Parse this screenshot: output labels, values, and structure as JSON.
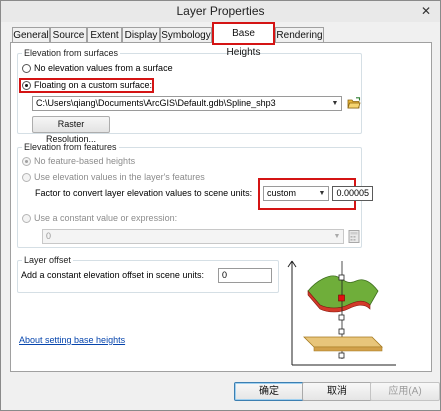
{
  "window": {
    "title": "Layer Properties",
    "close_glyph": "✕"
  },
  "tabs": [
    {
      "label": "General"
    },
    {
      "label": "Source"
    },
    {
      "label": "Extent"
    },
    {
      "label": "Display"
    },
    {
      "label": "Symbology"
    },
    {
      "label": "Base Heights",
      "selected": true
    },
    {
      "label": "Rendering"
    }
  ],
  "elevation_from_surfaces": {
    "legend": "Elevation from surfaces",
    "option_none": "No elevation values from a surface",
    "option_custom": "Floating on a custom surface:",
    "selected": "custom",
    "surface_path": "C:\\Users\\qiang\\Documents\\ArcGIS\\Default.gdb\\Spline_shp3",
    "raster_resolution_button": "Raster Resolution..."
  },
  "elevation_from_features": {
    "legend": "Elevation from features",
    "option_none": "No feature-based heights",
    "option_use_values": "Use elevation values in the layer's features",
    "factor_label": "Factor to convert layer elevation values to scene units:",
    "unit_value": "custom",
    "factor_value": "0.00005",
    "option_constant": "Use a constant value or expression:",
    "constant_value": "0"
  },
  "layer_offset": {
    "legend": "Layer offset",
    "label": "Add a constant elevation offset in scene units:",
    "value": "0"
  },
  "help_link": "About setting base heights",
  "buttons": {
    "ok": "确定",
    "cancel": "取消",
    "apply": "应用(A)"
  },
  "icons": {
    "browse": "open-folder-icon",
    "expression": "calculator-icon",
    "surface_diagram": "base-height-illustration"
  },
  "colors": {
    "highlight_red": "#d41414",
    "surface_green": "#6fae3a",
    "base_tan": "#e8c57a",
    "link_blue": "#0645ad"
  }
}
